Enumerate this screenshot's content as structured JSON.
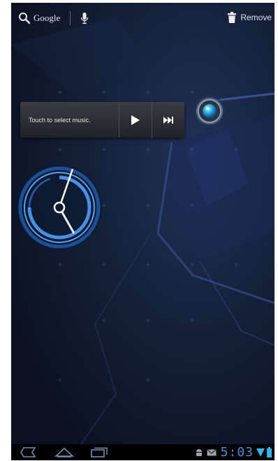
{
  "topbar": {
    "search_label": "Google",
    "remove_label": "Remove"
  },
  "music_widget": {
    "prompt": "Touch to select music."
  },
  "status_bar": {
    "time": "5:03"
  },
  "colors": {
    "accent": "#33b5e5",
    "wallpaper": "#0f1728"
  }
}
